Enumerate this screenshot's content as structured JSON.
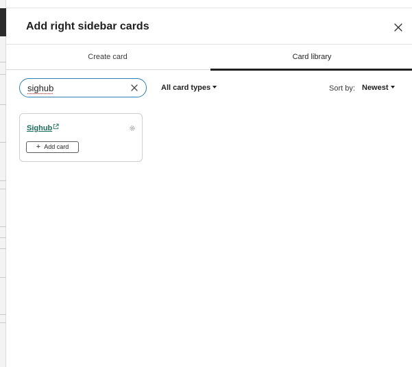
{
  "dialog": {
    "title": "Add right sidebar cards",
    "close_icon": "close-icon"
  },
  "tabs": [
    {
      "label": "Create card",
      "active": false
    },
    {
      "label": "Card library",
      "active": true
    }
  ],
  "search": {
    "value": "sighub",
    "clear_icon": "clear-icon"
  },
  "filters": {
    "card_types_label": "All card types",
    "sort_label": "Sort by:",
    "sort_value": "Newest"
  },
  "cards": [
    {
      "title": "Sighub",
      "external_icon": "external-link-icon",
      "settings_icon": "gear-icon",
      "add_label": "Add card"
    }
  ],
  "colors": {
    "link_green": "#1c6b5a",
    "focus_blue": "#2f7fb5",
    "tab_underline": "#1f1f1f"
  }
}
